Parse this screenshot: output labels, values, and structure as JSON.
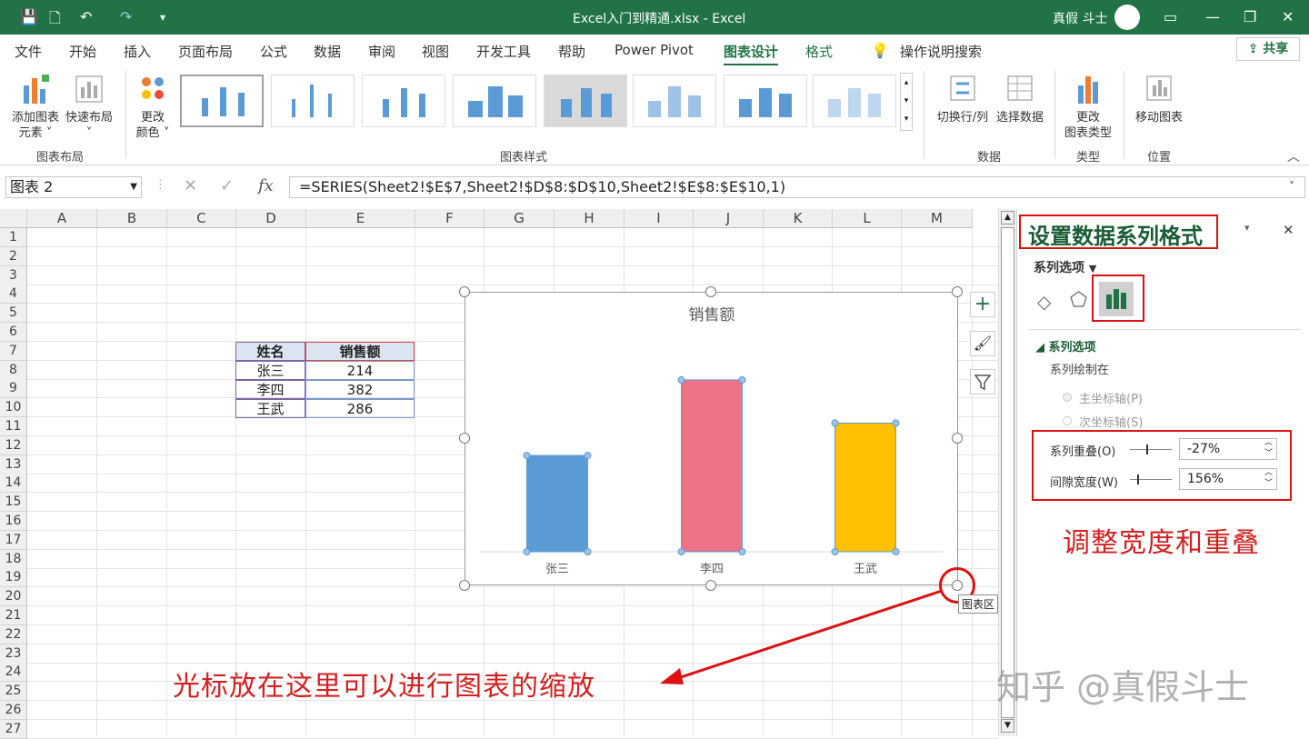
{
  "window": {
    "title": "Excel入门到精通.xlsx  -  Excel",
    "user": "真假 斗士"
  },
  "tabs": [
    "文件",
    "开始",
    "插入",
    "页面布局",
    "公式",
    "数据",
    "审阅",
    "视图",
    "开发工具",
    "帮助",
    "Power Pivot",
    "图表设计",
    "格式"
  ],
  "active_tab": "图表设计",
  "search": "操作说明搜索",
  "share": "共享",
  "ribbon": {
    "add_element": [
      "添加图表",
      "元素"
    ],
    "quick_layout": [
      "快速布局"
    ],
    "group_layout": "图表布局",
    "change_color": [
      "更改",
      "颜色"
    ],
    "group_styles": "图表样式",
    "switch": "切换行/列",
    "select_data": "选择数据",
    "group_data": "数据",
    "change_type": [
      "更改",
      "图表类型"
    ],
    "group_type": "类型",
    "move_chart": "移动图表",
    "group_location": "位置"
  },
  "namebox": "图表 2",
  "formula": "=SERIES(Sheet2!$E$7,Sheet2!$D$8:$D$10,Sheet2!$E$8:$E$10,1)",
  "columns": [
    "A",
    "B",
    "C",
    "D",
    "E",
    "F",
    "G",
    "H",
    "I",
    "J",
    "K",
    "L",
    "M"
  ],
  "rows": [
    "1",
    "2",
    "3",
    "4",
    "5",
    "6",
    "7",
    "8",
    "9",
    "10",
    "11",
    "12",
    "13",
    "14",
    "15",
    "16",
    "17",
    "18",
    "19",
    "20",
    "21",
    "22",
    "23",
    "24",
    "25",
    "26",
    "27"
  ],
  "table": {
    "headers": [
      "姓名",
      "销售额"
    ],
    "rows": [
      [
        "张三",
        "214"
      ],
      [
        "李四",
        "382"
      ],
      [
        "王武",
        "286"
      ]
    ]
  },
  "chart_data": {
    "type": "bar",
    "title": "销售额",
    "categories": [
      "张三",
      "李四",
      "王武"
    ],
    "values": [
      214,
      382,
      286
    ],
    "colors": [
      "#5b9bd5",
      "#ed7486",
      "#ffc000"
    ],
    "ylim": [
      0,
      400
    ]
  },
  "chart_tooltip": "图表区",
  "pane": {
    "title": "设置数据系列格式",
    "options_dropdown": "系列选项",
    "section": "系列选项",
    "plot_on": "系列绘制在",
    "primary": "主坐标轴(P)",
    "secondary": "次坐标轴(S)",
    "overlap_label": "系列重叠(O)",
    "overlap_value": "-27%",
    "gap_label": "间隙宽度(W)",
    "gap_value": "156%"
  },
  "annotations": {
    "resize": "光标放在这里可以进行图表的缩放",
    "adjust": "调整宽度和重叠"
  },
  "watermark": "知乎 @真假斗士"
}
